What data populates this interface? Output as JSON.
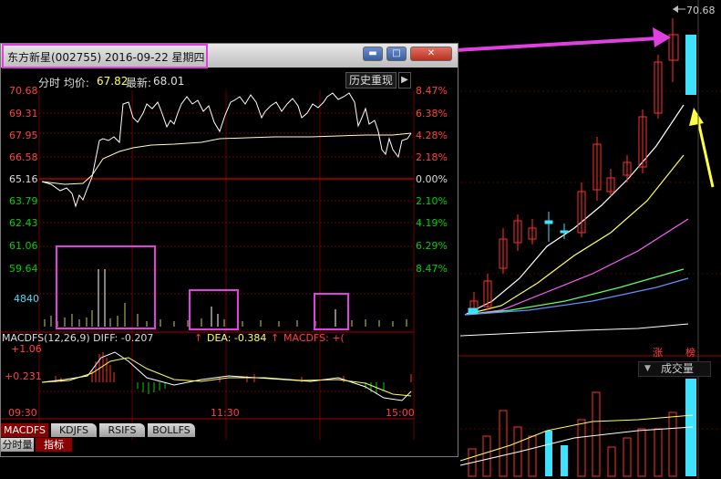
{
  "stock": {
    "title": "东方新星(002755) 2016-09-22 星期四",
    "avg_label": "分时 均价:",
    "avg_value": "67.82",
    "latest_label": "最新:",
    "latest_value": "68.01",
    "history_button": "历史重现"
  },
  "right_chart": {
    "top_price": "70.68",
    "zhang_label": "涨",
    "bang_label": "榜",
    "volume_dropdown": "成交量"
  },
  "window_buttons": {
    "minimize": "▬",
    "maximize": "□",
    "close": "✕"
  },
  "price_axis_left": [
    "70.68",
    "69.31",
    "67.95",
    "66.58",
    "65.16",
    "63.79",
    "62.43",
    "61.06",
    "59.64"
  ],
  "price_axis_right": [
    "8.47%",
    "6.38%",
    "4.28%",
    "2.18%",
    "0.00%",
    "2.10%",
    "4.19%",
    "6.29%",
    "8.47%"
  ],
  "volume_label": "4840",
  "macd": {
    "header": "MACDFS(12,26,9) DIFF: -0.207",
    "dea": "DEA: -0.384",
    "macdfs": "MACDFS: +(",
    "up_level": "+1.06",
    "mid_level": "+0.231"
  },
  "time_axis": [
    "09:30",
    "11:30",
    "15:00"
  ],
  "tabs": [
    "MACDFS",
    "KDJFS",
    "RSIFS",
    "BOLLFS"
  ],
  "tabs2": [
    "分时量",
    "指标"
  ],
  "colors": {
    "up_red": "#ff3030",
    "down_green": "#00d000",
    "cyan": "#40e0ff",
    "magenta_box": "#e040e0",
    "arrow_yellow": "#ffff40"
  }
}
